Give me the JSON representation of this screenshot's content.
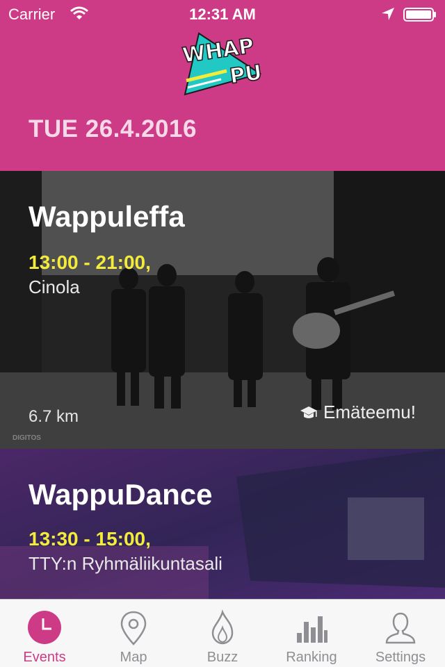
{
  "status_bar": {
    "carrier": "Carrier",
    "time": "12:31 AM",
    "icons": [
      "wifi-icon",
      "location-arrow-icon",
      "battery-icon"
    ]
  },
  "header": {
    "logo_text": "WHAPPU",
    "date": "TUE 26.4.2016",
    "colors": {
      "background": "#cd3a86",
      "date_text": "#f6d9e8",
      "logo_triangle": "#22c9c4",
      "logo_accent": "#f3ec3a"
    }
  },
  "events": [
    {
      "title": "Wappuleffa",
      "time": "13:00 - 21:00,",
      "venue": "Cinola",
      "distance": "6.7 km",
      "organizer_icon": "graduation-cap-icon",
      "organizer": "Emäteemu!",
      "photo_watermark": "DIGITOS"
    },
    {
      "title": "WappuDance",
      "time": "13:30 - 15:00,",
      "venue": "TTY:n Ryhmäliikuntasali"
    }
  ],
  "tab_bar": {
    "active": "Events",
    "active_color": "#cd3a86",
    "tabs": [
      {
        "label": "Events",
        "icon": "clock-icon"
      },
      {
        "label": "Map",
        "icon": "map-pin-icon"
      },
      {
        "label": "Buzz",
        "icon": "flame-icon"
      },
      {
        "label": "Ranking",
        "icon": "bar-chart-icon"
      },
      {
        "label": "Settings",
        "icon": "user-icon"
      }
    ]
  }
}
